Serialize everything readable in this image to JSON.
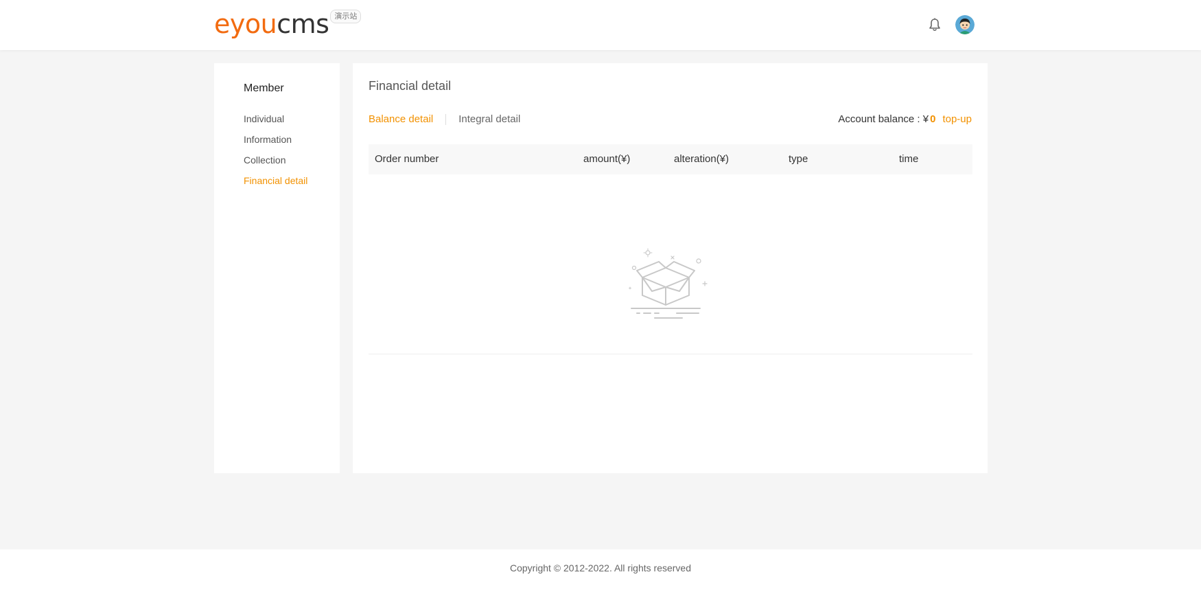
{
  "header": {
    "logo_part1": "eyou",
    "logo_part2": "cms",
    "logo_badge": "演示站",
    "bell_icon": "bell-icon",
    "avatar_icon": "avatar-icon"
  },
  "sidebar": {
    "title": "Member",
    "items": [
      {
        "label": "Individual",
        "active": false
      },
      {
        "label": "Information",
        "active": false
      },
      {
        "label": "Collection",
        "active": false
      },
      {
        "label": "Financial detail",
        "active": true
      }
    ]
  },
  "main": {
    "title": "Financial detail",
    "tabs": [
      {
        "label": "Balance detail",
        "active": true
      },
      {
        "label": "Integral detail",
        "active": false
      }
    ],
    "balance_label": "Account balance :  ¥",
    "balance_amount": "0",
    "topup_label": "top-up",
    "table_headers": [
      "Order number",
      "amount(¥)",
      "alteration(¥)",
      "type",
      "time"
    ],
    "empty_icon": "empty-box-icon"
  },
  "footer": {
    "copyright": "Copyright © 2012-2022. All rights reserved"
  },
  "colors": {
    "accent": "#f29100",
    "logo_orange": "#f26b10",
    "background": "#f5f5f5"
  }
}
